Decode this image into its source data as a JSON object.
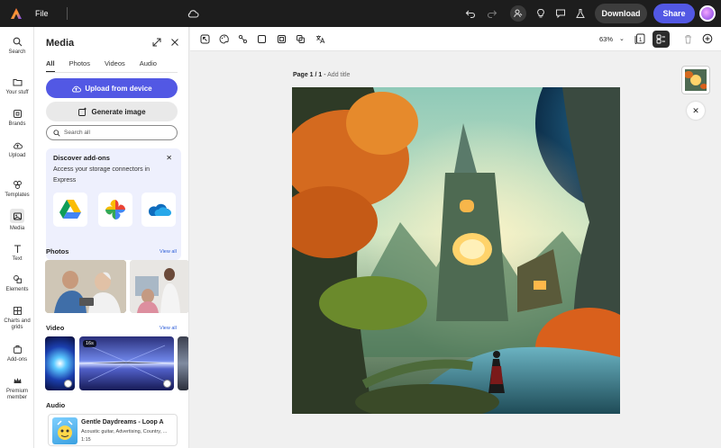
{
  "topbar": {
    "file_label": "File",
    "download_label": "Download",
    "share_label": "Share",
    "icons": [
      "adobe-express-logo",
      "cloud-icon",
      "undo-icon",
      "redo-icon",
      "collaborate-icon",
      "lightbulb-icon",
      "comment-icon",
      "flask-icon"
    ]
  },
  "rail": {
    "items": [
      {
        "label": "Search",
        "icon": "search-icon"
      },
      {
        "label": "Your stuff",
        "icon": "folder-icon"
      },
      {
        "label": "Brands",
        "icon": "brand-icon"
      },
      {
        "label": "Upload",
        "icon": "upload-icon"
      },
      {
        "label": "Templates",
        "icon": "templates-icon"
      },
      {
        "label": "Media",
        "icon": "media-icon"
      },
      {
        "label": "Text",
        "icon": "text-icon"
      },
      {
        "label": "Elements",
        "icon": "elements-icon"
      },
      {
        "label": "Charts and grids",
        "icon": "chart-icon"
      },
      {
        "label": "Add-ons",
        "icon": "addons-icon"
      },
      {
        "label": "Premium member",
        "icon": "crown-icon"
      }
    ]
  },
  "panel": {
    "title": "Media",
    "tabs": [
      "All",
      "Photos",
      "Videos",
      "Audio"
    ],
    "upload_label": "Upload from device",
    "generate_label": "Generate image",
    "search_placeholder": "Search all",
    "addons": {
      "title": "Discover add-ons",
      "description": "Access your storage connectors in Express",
      "connectors": [
        "google-drive-icon",
        "google-photos-icon",
        "onedrive-icon"
      ]
    },
    "photos_title": "Photos",
    "videos_title": "Video",
    "audio_title": "Audio",
    "view_all": "View all",
    "video_duration": "16s",
    "audio": {
      "title": "Gentle Daydreams - Loop A",
      "meta": "Acoustic guitar, Advertising, Country, ...",
      "duration": "1:15"
    }
  },
  "toolbar": {
    "zoom": "63%",
    "page_count": "1"
  },
  "canvas": {
    "page_label": "Page 1 / 1",
    "title_placeholder": "Add title"
  },
  "colors": {
    "accent": "#5258e4",
    "topbar": "#1d1d1d"
  }
}
